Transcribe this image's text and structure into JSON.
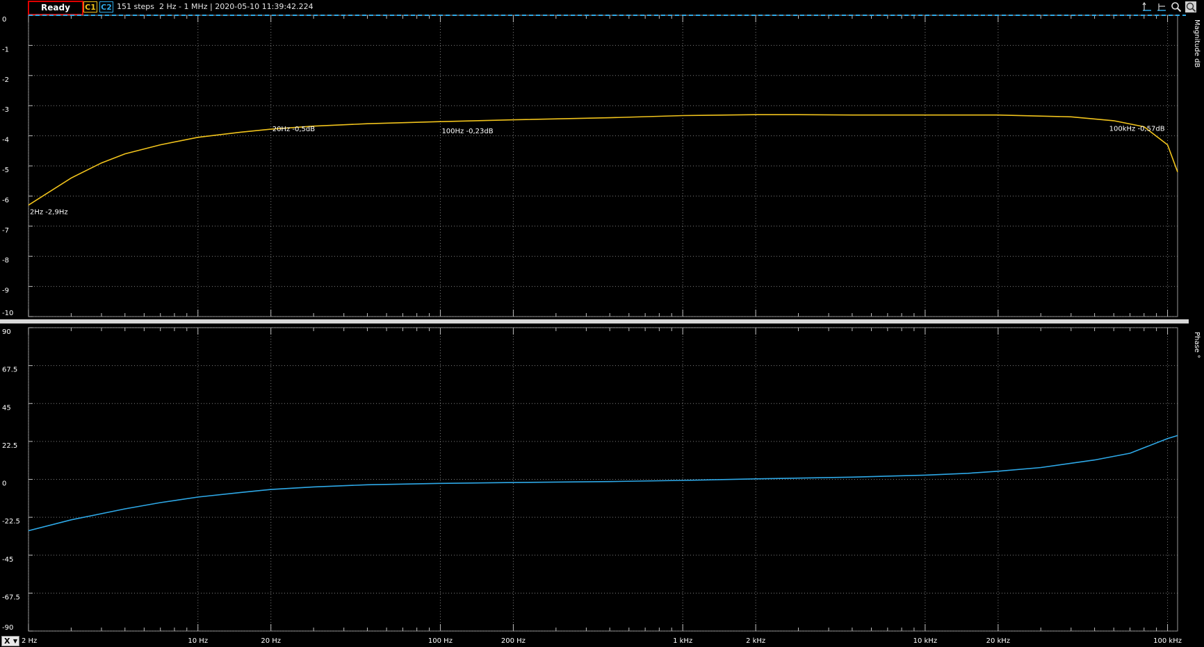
{
  "toolbar": {
    "status": "Ready",
    "channel1": "C1",
    "channel2": "C2",
    "info": "151 steps  2 Hz - 1 MHz | 2020-05-10 11:39:42.224",
    "x_selector": "X"
  },
  "colors": {
    "c1": "#f2c41c",
    "c2": "#2ea9e8",
    "status_border": "#e00000",
    "grid": "#808080"
  },
  "icons": [
    "cursor-h-icon",
    "cursor-v-icon",
    "zoom-icon",
    "autoscale-icon"
  ],
  "chart_data": [
    {
      "type": "line",
      "name": "magnitude",
      "ylabel": "Magnitude  dB",
      "xscale": "log",
      "xlim": [
        2,
        110000
      ],
      "ylim": [
        -10,
        0
      ],
      "yticks": [
        0,
        -1,
        -2,
        -3,
        -4,
        -5,
        -6,
        -7,
        -8,
        -9,
        -10
      ],
      "ytick_labels": [
        "0",
        "-1",
        "-2",
        "-3",
        "-4",
        "-5",
        "-6",
        "-7",
        "-8",
        "-9",
        "-10"
      ],
      "grid": true,
      "reference_line": 0,
      "series": [
        {
          "color": "#f2c41c",
          "x": [
            2,
            3,
            4,
            5,
            7,
            10,
            15,
            20,
            30,
            50,
            100,
            200,
            500,
            1000,
            2000,
            3000,
            5000,
            10000,
            20000,
            40000,
            60000,
            80000,
            100000,
            110000
          ],
          "y": [
            -6.3,
            -5.4,
            -4.9,
            -4.6,
            -4.3,
            -4.05,
            -3.88,
            -3.78,
            -3.68,
            -3.6,
            -3.53,
            -3.47,
            -3.4,
            -3.33,
            -3.3,
            -3.3,
            -3.31,
            -3.31,
            -3.31,
            -3.37,
            -3.5,
            -3.7,
            -4.3,
            -5.2
          ]
        }
      ],
      "annotations": [
        {
          "x": 2,
          "y": -6.3,
          "text": "2Hz -2,9Hz"
        },
        {
          "x": 20,
          "y": -3.78,
          "text": "20Hz -0,5dB"
        },
        {
          "x": 100,
          "y": -3.53,
          "text": "100Hz -0,23dB"
        },
        {
          "x": 100000,
          "y": -4.3,
          "text": "100kHz -0,57dB"
        }
      ]
    },
    {
      "type": "line",
      "name": "phase",
      "ylabel": "Phase  °",
      "xscale": "log",
      "xlim": [
        2,
        110000
      ],
      "ylim": [
        -90,
        90
      ],
      "yticks": [
        90,
        67.5,
        45,
        22.5,
        0,
        -22.5,
        -45,
        -67.5,
        -90
      ],
      "ytick_labels": [
        "90",
        "67.5",
        "45",
        "22.5",
        "0",
        "-22.5",
        "-45",
        "-67.5",
        "-90"
      ],
      "grid": true,
      "xticks": [
        2,
        10,
        20,
        100,
        200,
        1000,
        2000,
        10000,
        20000,
        100000
      ],
      "xtick_labels": [
        "2 Hz",
        "10 Hz",
        "20 Hz",
        "100 Hz",
        "200 Hz",
        "1 kHz",
        "2 kHz",
        "10 kHz",
        "20 kHz",
        "100 kHz"
      ],
      "series": [
        {
          "color": "#2ea9e8",
          "x": [
            2,
            3,
            5,
            7,
            10,
            15,
            20,
            30,
            50,
            100,
            200,
            500,
            1000,
            2000,
            5000,
            10000,
            15000,
            20000,
            30000,
            50000,
            70000,
            100000,
            110000
          ],
          "y": [
            -30.5,
            -24,
            -17.5,
            -13.8,
            -10.5,
            -7.8,
            -6,
            -4.5,
            -3.2,
            -2.4,
            -1.9,
            -1.3,
            -0.6,
            0.3,
            1.3,
            2.5,
            3.6,
            4.8,
            7,
            11.5,
            15.5,
            24.2,
            26
          ]
        }
      ]
    }
  ]
}
